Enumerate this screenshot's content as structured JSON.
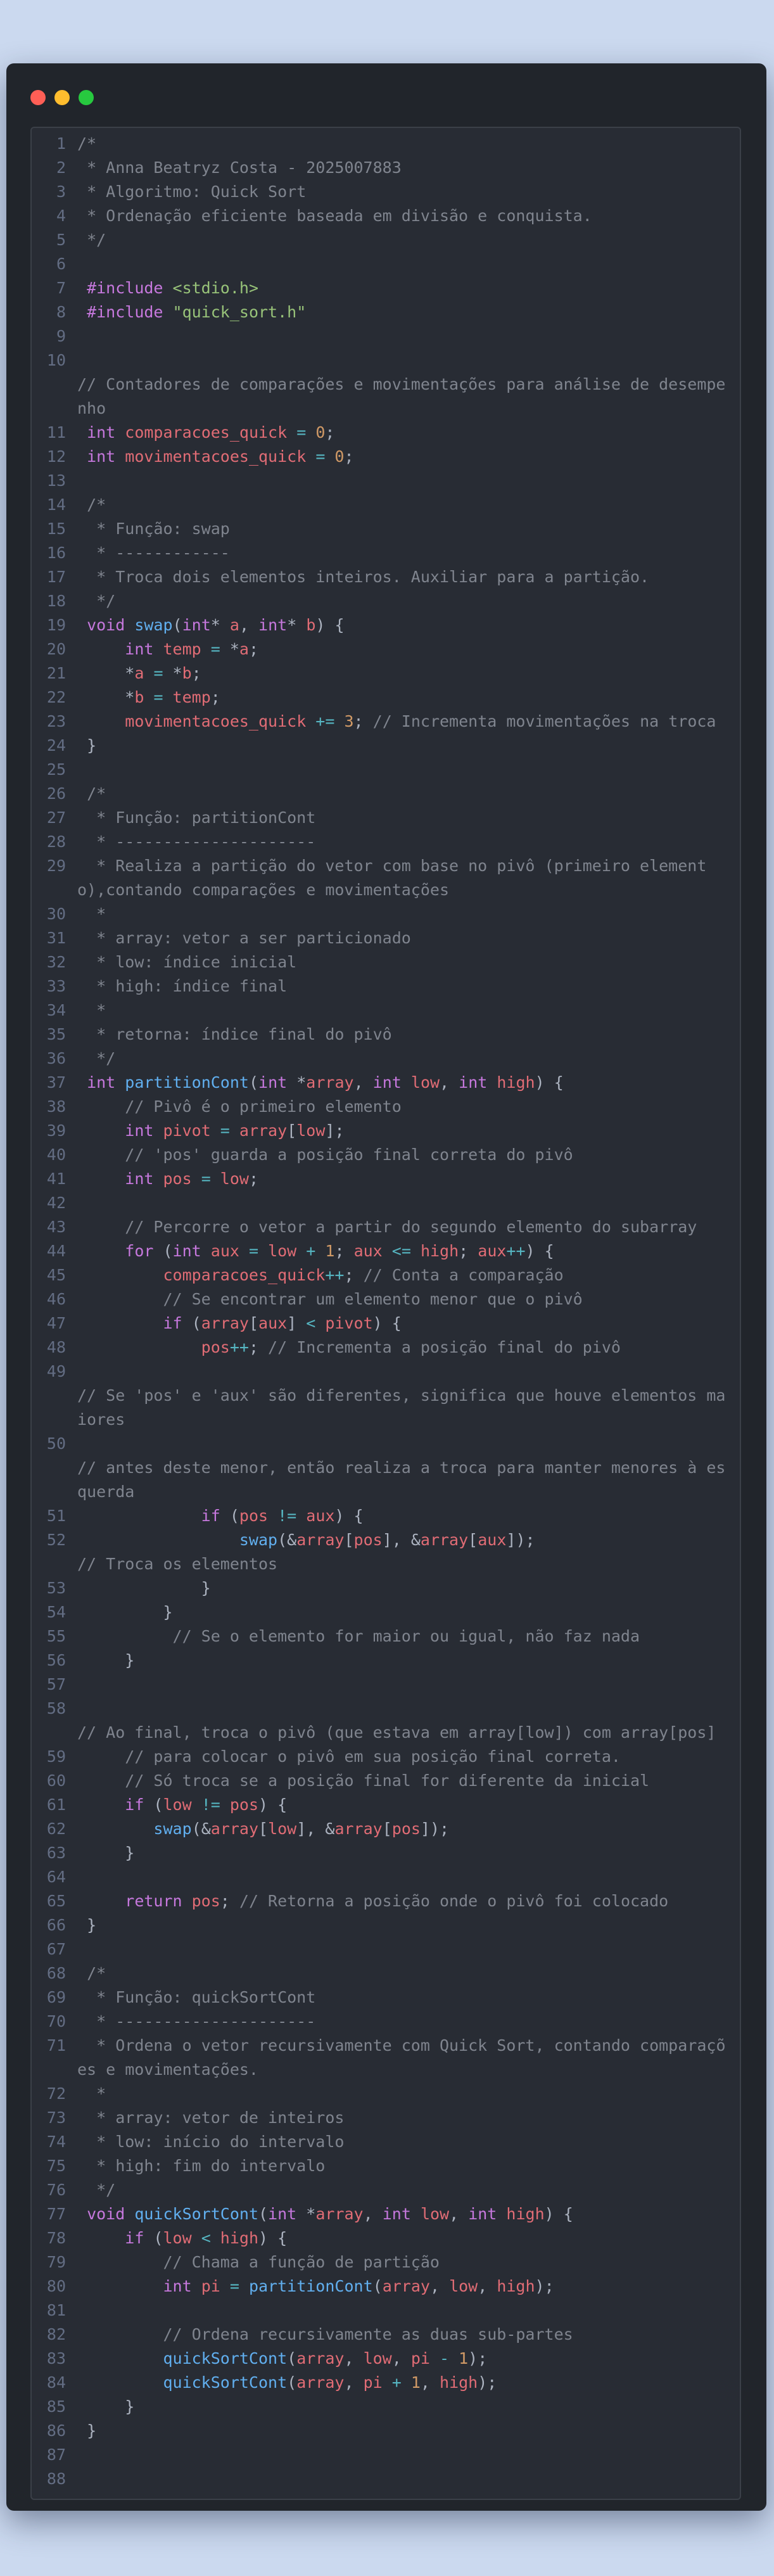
{
  "window": {
    "controls": [
      "close-button",
      "minimize-button",
      "zoom-button"
    ]
  },
  "colors": {
    "comment": "#7f848e",
    "keyword": "#c678dd",
    "variable": "#e06c75",
    "number": "#d19a66",
    "function": "#61afef",
    "string": "#98c379",
    "operator": "#56b6c2",
    "plain": "#abb2bf"
  },
  "code_lines": [
    {
      "n": "1",
      "t": [
        [
          "c",
          "/*"
        ]
      ]
    },
    {
      "n": "2",
      "t": [
        [
          "c",
          " * Anna Beatryz Costa - 2025007883"
        ]
      ]
    },
    {
      "n": "3",
      "t": [
        [
          "c",
          " * Algoritmo: Quick Sort"
        ]
      ]
    },
    {
      "n": "4",
      "t": [
        [
          "c",
          " * Ordenação eficiente baseada em divisão e conquista."
        ]
      ]
    },
    {
      "n": "5",
      "t": [
        [
          "c",
          " */"
        ]
      ]
    },
    {
      "n": "6",
      "t": []
    },
    {
      "n": "7",
      "t": [
        [
          "k",
          " #include "
        ],
        [
          "s",
          "<stdio.h>"
        ]
      ]
    },
    {
      "n": "8",
      "t": [
        [
          "k",
          " #include "
        ],
        [
          "s",
          "\"quick_sort.h\""
        ]
      ]
    },
    {
      "n": "9",
      "t": []
    },
    {
      "n": "10",
      "t": []
    },
    {
      "n": "",
      "t": [
        [
          "c",
          "// Contadores de comparações e movimentações para análise de desempenho"
        ]
      ]
    },
    {
      "n": "11",
      "t": [
        [
          "k",
          " int "
        ],
        [
          "v",
          "comparacoes_quick"
        ],
        [
          "o",
          " = "
        ],
        [
          "n",
          "0"
        ],
        [
          "p",
          ";"
        ]
      ]
    },
    {
      "n": "12",
      "t": [
        [
          "k",
          " int "
        ],
        [
          "v",
          "movimentacoes_quick"
        ],
        [
          "o",
          " = "
        ],
        [
          "n",
          "0"
        ],
        [
          "p",
          ";"
        ]
      ]
    },
    {
      "n": "13",
      "t": []
    },
    {
      "n": "14",
      "t": [
        [
          "c",
          " /*"
        ]
      ]
    },
    {
      "n": "15",
      "t": [
        [
          "c",
          "  * Função: swap"
        ]
      ]
    },
    {
      "n": "16",
      "t": [
        [
          "c",
          "  * ------------"
        ]
      ]
    },
    {
      "n": "17",
      "t": [
        [
          "c",
          "  * Troca dois elementos inteiros. Auxiliar para a partição."
        ]
      ]
    },
    {
      "n": "18",
      "t": [
        [
          "c",
          "  */"
        ]
      ]
    },
    {
      "n": "19",
      "t": [
        [
          "k",
          " void "
        ],
        [
          "f",
          "swap"
        ],
        [
          "p",
          "("
        ],
        [
          "k",
          "int"
        ],
        [
          "p",
          "* "
        ],
        [
          "v",
          "a"
        ],
        [
          "p",
          ", "
        ],
        [
          "k",
          "int"
        ],
        [
          "p",
          "* "
        ],
        [
          "v",
          "b"
        ],
        [
          "p",
          ") {"
        ]
      ]
    },
    {
      "n": "20",
      "t": [
        [
          "k",
          "     int "
        ],
        [
          "v",
          "temp"
        ],
        [
          "o",
          " = "
        ],
        [
          "p",
          "*"
        ],
        [
          "v",
          "a"
        ],
        [
          "p",
          ";"
        ]
      ]
    },
    {
      "n": "21",
      "t": [
        [
          "p",
          "     *"
        ],
        [
          "v",
          "a"
        ],
        [
          "o",
          " = "
        ],
        [
          "p",
          "*"
        ],
        [
          "v",
          "b"
        ],
        [
          "p",
          ";"
        ]
      ]
    },
    {
      "n": "22",
      "t": [
        [
          "p",
          "     *"
        ],
        [
          "v",
          "b"
        ],
        [
          "o",
          " = "
        ],
        [
          "v",
          "temp"
        ],
        [
          "p",
          ";"
        ]
      ]
    },
    {
      "n": "23",
      "t": [
        [
          "v",
          "     movimentacoes_quick"
        ],
        [
          "o",
          " += "
        ],
        [
          "n",
          "3"
        ],
        [
          "p",
          "; "
        ],
        [
          "c",
          "// Incrementa movimentações na troca"
        ]
      ]
    },
    {
      "n": "24",
      "t": [
        [
          "p",
          " }"
        ]
      ]
    },
    {
      "n": "25",
      "t": []
    },
    {
      "n": "26",
      "t": [
        [
          "c",
          " /*"
        ]
      ]
    },
    {
      "n": "27",
      "t": [
        [
          "c",
          "  * Função: partitionCont"
        ]
      ]
    },
    {
      "n": "28",
      "t": [
        [
          "c",
          "  * ---------------------"
        ]
      ]
    },
    {
      "n": "29",
      "t": [
        [
          "c",
          "  * Realiza a partição do vetor com base no pivô (primeiro elemento),contando comparações e movimentações"
        ]
      ]
    },
    {
      "n": "30",
      "t": [
        [
          "c",
          "  *"
        ]
      ]
    },
    {
      "n": "31",
      "t": [
        [
          "c",
          "  * array: vetor a ser particionado"
        ]
      ]
    },
    {
      "n": "32",
      "t": [
        [
          "c",
          "  * low: índice inicial"
        ]
      ]
    },
    {
      "n": "33",
      "t": [
        [
          "c",
          "  * high: índice final"
        ]
      ]
    },
    {
      "n": "34",
      "t": [
        [
          "c",
          "  *"
        ]
      ]
    },
    {
      "n": "35",
      "t": [
        [
          "c",
          "  * retorna: índice final do pivô"
        ]
      ]
    },
    {
      "n": "36",
      "t": [
        [
          "c",
          "  */"
        ]
      ]
    },
    {
      "n": "37",
      "t": [
        [
          "k",
          " int "
        ],
        [
          "f",
          "partitionCont"
        ],
        [
          "p",
          "("
        ],
        [
          "k",
          "int "
        ],
        [
          "p",
          "*"
        ],
        [
          "v",
          "array"
        ],
        [
          "p",
          ", "
        ],
        [
          "k",
          "int "
        ],
        [
          "v",
          "low"
        ],
        [
          "p",
          ", "
        ],
        [
          "k",
          "int "
        ],
        [
          "v",
          "high"
        ],
        [
          "p",
          ") {"
        ]
      ]
    },
    {
      "n": "38",
      "t": [
        [
          "c",
          "     // Pivô é o primeiro elemento"
        ]
      ]
    },
    {
      "n": "39",
      "t": [
        [
          "k",
          "     int "
        ],
        [
          "v",
          "pivot"
        ],
        [
          "o",
          " = "
        ],
        [
          "v",
          "array"
        ],
        [
          "p",
          "["
        ],
        [
          "v",
          "low"
        ],
        [
          "p",
          "];"
        ]
      ]
    },
    {
      "n": "40",
      "t": [
        [
          "c",
          "     // 'pos' guarda a posição final correta do pivô"
        ]
      ]
    },
    {
      "n": "41",
      "t": [
        [
          "k",
          "     int "
        ],
        [
          "v",
          "pos"
        ],
        [
          "o",
          " = "
        ],
        [
          "v",
          "low"
        ],
        [
          "p",
          ";"
        ]
      ]
    },
    {
      "n": "42",
      "t": []
    },
    {
      "n": "43",
      "t": [
        [
          "c",
          "     // Percorre o vetor a partir do segundo elemento do subarray"
        ]
      ]
    },
    {
      "n": "44",
      "t": [
        [
          "k",
          "     for "
        ],
        [
          "p",
          "("
        ],
        [
          "k",
          "int "
        ],
        [
          "v",
          "aux"
        ],
        [
          "o",
          " = "
        ],
        [
          "v",
          "low"
        ],
        [
          "o",
          " + "
        ],
        [
          "n",
          "1"
        ],
        [
          "p",
          "; "
        ],
        [
          "v",
          "aux"
        ],
        [
          "o",
          " <= "
        ],
        [
          "v",
          "high"
        ],
        [
          "p",
          "; "
        ],
        [
          "v",
          "aux"
        ],
        [
          "o",
          "++"
        ],
        [
          "p",
          ") {"
        ]
      ]
    },
    {
      "n": "45",
      "t": [
        [
          "v",
          "         comparacoes_quick"
        ],
        [
          "o",
          "++"
        ],
        [
          "p",
          "; "
        ],
        [
          "c",
          "// Conta a comparação"
        ]
      ]
    },
    {
      "n": "46",
      "t": [
        [
          "c",
          "         // Se encontrar um elemento menor que o pivô"
        ]
      ]
    },
    {
      "n": "47",
      "t": [
        [
          "k",
          "         if "
        ],
        [
          "p",
          "("
        ],
        [
          "v",
          "array"
        ],
        [
          "p",
          "["
        ],
        [
          "v",
          "aux"
        ],
        [
          "p",
          "]"
        ],
        [
          "o",
          " < "
        ],
        [
          "v",
          "pivot"
        ],
        [
          "p",
          ") {"
        ]
      ]
    },
    {
      "n": "48",
      "t": [
        [
          "v",
          "             pos"
        ],
        [
          "o",
          "++"
        ],
        [
          "p",
          "; "
        ],
        [
          "c",
          "// Incrementa a posição final do pivô"
        ]
      ]
    },
    {
      "n": "49",
      "t": []
    },
    {
      "n": "",
      "t": [
        [
          "c",
          "// Se 'pos' e 'aux' são diferentes, significa que houve elementos maiores"
        ]
      ]
    },
    {
      "n": "50",
      "t": []
    },
    {
      "n": "",
      "t": [
        [
          "c",
          "// antes deste menor, então realiza a troca para manter menores à esquerda"
        ]
      ]
    },
    {
      "n": "51",
      "t": [
        [
          "k",
          "             if "
        ],
        [
          "p",
          "("
        ],
        [
          "v",
          "pos"
        ],
        [
          "o",
          " != "
        ],
        [
          "v",
          "aux"
        ],
        [
          "p",
          ") {"
        ]
      ]
    },
    {
      "n": "52",
      "t": [
        [
          "f",
          "                 swap"
        ],
        [
          "p",
          "(&"
        ],
        [
          "v",
          "array"
        ],
        [
          "p",
          "["
        ],
        [
          "v",
          "pos"
        ],
        [
          "p",
          "], &"
        ],
        [
          "v",
          "array"
        ],
        [
          "p",
          "["
        ],
        [
          "v",
          "aux"
        ],
        [
          "p",
          "]);"
        ]
      ]
    },
    {
      "n": "",
      "t": [
        [
          "c",
          "// Troca os elementos"
        ]
      ]
    },
    {
      "n": "53",
      "t": [
        [
          "p",
          "             }"
        ]
      ]
    },
    {
      "n": "54",
      "t": [
        [
          "p",
          "         }"
        ]
      ]
    },
    {
      "n": "55",
      "t": [
        [
          "c",
          "          // Se o elemento for maior ou igual, não faz nada"
        ]
      ]
    },
    {
      "n": "56",
      "t": [
        [
          "p",
          "     }"
        ]
      ]
    },
    {
      "n": "57",
      "t": []
    },
    {
      "n": "58",
      "t": []
    },
    {
      "n": "",
      "t": [
        [
          "c",
          "// Ao final, troca o pivô (que estava em array[low]) com array[pos]"
        ]
      ]
    },
    {
      "n": "59",
      "t": [
        [
          "c",
          "     // para colocar o pivô em sua posição final correta."
        ]
      ]
    },
    {
      "n": "60",
      "t": [
        [
          "c",
          "     // Só troca se a posição final for diferente da inicial"
        ]
      ]
    },
    {
      "n": "61",
      "t": [
        [
          "k",
          "     if "
        ],
        [
          "p",
          "("
        ],
        [
          "v",
          "low"
        ],
        [
          "o",
          " != "
        ],
        [
          "v",
          "pos"
        ],
        [
          "p",
          ") {"
        ]
      ]
    },
    {
      "n": "62",
      "t": [
        [
          "f",
          "        swap"
        ],
        [
          "p",
          "(&"
        ],
        [
          "v",
          "array"
        ],
        [
          "p",
          "["
        ],
        [
          "v",
          "low"
        ],
        [
          "p",
          "], &"
        ],
        [
          "v",
          "array"
        ],
        [
          "p",
          "["
        ],
        [
          "v",
          "pos"
        ],
        [
          "p",
          "]);"
        ]
      ]
    },
    {
      "n": "63",
      "t": [
        [
          "p",
          "     }"
        ]
      ]
    },
    {
      "n": "64",
      "t": []
    },
    {
      "n": "65",
      "t": [
        [
          "k",
          "     return "
        ],
        [
          "v",
          "pos"
        ],
        [
          "p",
          "; "
        ],
        [
          "c",
          "// Retorna a posição onde o pivô foi colocado"
        ]
      ]
    },
    {
      "n": "66",
      "t": [
        [
          "p",
          " }"
        ]
      ]
    },
    {
      "n": "67",
      "t": []
    },
    {
      "n": "68",
      "t": [
        [
          "c",
          " /*"
        ]
      ]
    },
    {
      "n": "69",
      "t": [
        [
          "c",
          "  * Função: quickSortCont"
        ]
      ]
    },
    {
      "n": "70",
      "t": [
        [
          "c",
          "  * ---------------------"
        ]
      ]
    },
    {
      "n": "71",
      "t": [
        [
          "c",
          "  * Ordena o vetor recursivamente com Quick Sort, contando comparações e movimentações."
        ]
      ]
    },
    {
      "n": "72",
      "t": [
        [
          "c",
          "  *"
        ]
      ]
    },
    {
      "n": "73",
      "t": [
        [
          "c",
          "  * array: vetor de inteiros"
        ]
      ]
    },
    {
      "n": "74",
      "t": [
        [
          "c",
          "  * low: início do intervalo"
        ]
      ]
    },
    {
      "n": "75",
      "t": [
        [
          "c",
          "  * high: fim do intervalo"
        ]
      ]
    },
    {
      "n": "76",
      "t": [
        [
          "c",
          "  */"
        ]
      ]
    },
    {
      "n": "77",
      "t": [
        [
          "k",
          " void "
        ],
        [
          "f",
          "quickSortCont"
        ],
        [
          "p",
          "("
        ],
        [
          "k",
          "int "
        ],
        [
          "p",
          "*"
        ],
        [
          "v",
          "array"
        ],
        [
          "p",
          ", "
        ],
        [
          "k",
          "int "
        ],
        [
          "v",
          "low"
        ],
        [
          "p",
          ", "
        ],
        [
          "k",
          "int "
        ],
        [
          "v",
          "high"
        ],
        [
          "p",
          ") {"
        ]
      ]
    },
    {
      "n": "78",
      "t": [
        [
          "k",
          "     if "
        ],
        [
          "p",
          "("
        ],
        [
          "v",
          "low"
        ],
        [
          "o",
          " < "
        ],
        [
          "v",
          "high"
        ],
        [
          "p",
          ") {"
        ]
      ]
    },
    {
      "n": "79",
      "t": [
        [
          "c",
          "         // Chama a função de partição"
        ]
      ]
    },
    {
      "n": "80",
      "t": [
        [
          "k",
          "         int "
        ],
        [
          "v",
          "pi"
        ],
        [
          "o",
          " = "
        ],
        [
          "f",
          "partitionCont"
        ],
        [
          "p",
          "("
        ],
        [
          "v",
          "array"
        ],
        [
          "p",
          ", "
        ],
        [
          "v",
          "low"
        ],
        [
          "p",
          ", "
        ],
        [
          "v",
          "high"
        ],
        [
          "p",
          ");"
        ]
      ]
    },
    {
      "n": "81",
      "t": []
    },
    {
      "n": "82",
      "t": [
        [
          "c",
          "         // Ordena recursivamente as duas sub-partes"
        ]
      ]
    },
    {
      "n": "83",
      "t": [
        [
          "f",
          "         quickSortCont"
        ],
        [
          "p",
          "("
        ],
        [
          "v",
          "array"
        ],
        [
          "p",
          ", "
        ],
        [
          "v",
          "low"
        ],
        [
          "p",
          ", "
        ],
        [
          "v",
          "pi"
        ],
        [
          "o",
          " - "
        ],
        [
          "n",
          "1"
        ],
        [
          "p",
          ");"
        ]
      ]
    },
    {
      "n": "84",
      "t": [
        [
          "f",
          "         quickSortCont"
        ],
        [
          "p",
          "("
        ],
        [
          "v",
          "array"
        ],
        [
          "p",
          ", "
        ],
        [
          "v",
          "pi"
        ],
        [
          "o",
          " + "
        ],
        [
          "n",
          "1"
        ],
        [
          "p",
          ", "
        ],
        [
          "v",
          "high"
        ],
        [
          "p",
          ");"
        ]
      ]
    },
    {
      "n": "85",
      "t": [
        [
          "p",
          "     }"
        ]
      ]
    },
    {
      "n": "86",
      "t": [
        [
          "p",
          " }"
        ]
      ]
    },
    {
      "n": "87",
      "t": []
    },
    {
      "n": "88",
      "t": []
    }
  ]
}
